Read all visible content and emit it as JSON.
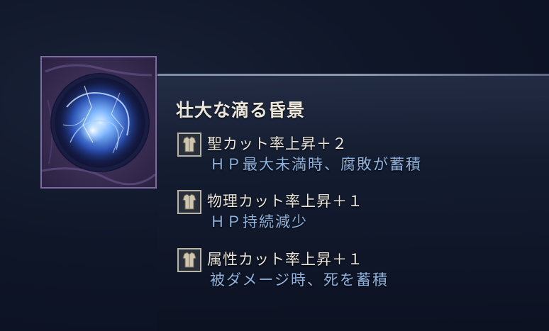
{
  "item": {
    "name": "壮大な滴る昏景",
    "image_icon": "blue-storm-orb-icon",
    "frame_color": "#7e6aa0"
  },
  "effects": [
    {
      "icon": "armor-icon",
      "name": "聖カット率上昇＋２",
      "description": "ＨＰ最大未満時、腐敗が蓄積"
    },
    {
      "icon": "armor-icon",
      "name": "物理カット率上昇＋１",
      "description": "ＨＰ持続減少"
    },
    {
      "icon": "armor-icon",
      "name": "属性カット率上昇＋１",
      "description": "被ダメージ時、死を蓄積"
    }
  ],
  "colors": {
    "name_text": "#ece7dc",
    "effect_text": "#e8e4da",
    "description_text": "#8fb3e0"
  }
}
